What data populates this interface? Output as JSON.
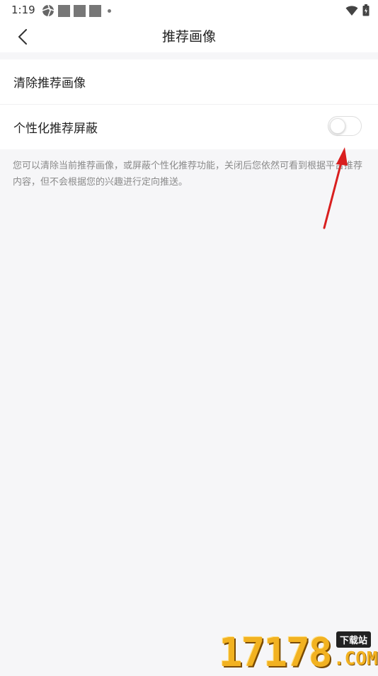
{
  "status_bar": {
    "time": "1:19"
  },
  "nav": {
    "title": "推荐画像"
  },
  "settings": {
    "clear_label": "清除推荐画像",
    "personalized_block_label": "个性化推荐屏蔽",
    "toggle_state": "off"
  },
  "description": "您可以清除当前推荐画像，或屏蔽个性化推荐功能，关闭后您依然可看到根据平台推荐内容，但不会根据您的兴趣进行定向推送。",
  "watermark": {
    "digits": "17178",
    "badge": "下载站",
    "domain": ".COM"
  },
  "colors": {
    "background": "#f6f6f8",
    "card": "#ffffff",
    "arrow": "#d91f1f",
    "watermark": "#f2b221"
  },
  "icons": [
    "back-arrow-icon",
    "aperture-icon",
    "wifi-icon",
    "battery-icon"
  ]
}
